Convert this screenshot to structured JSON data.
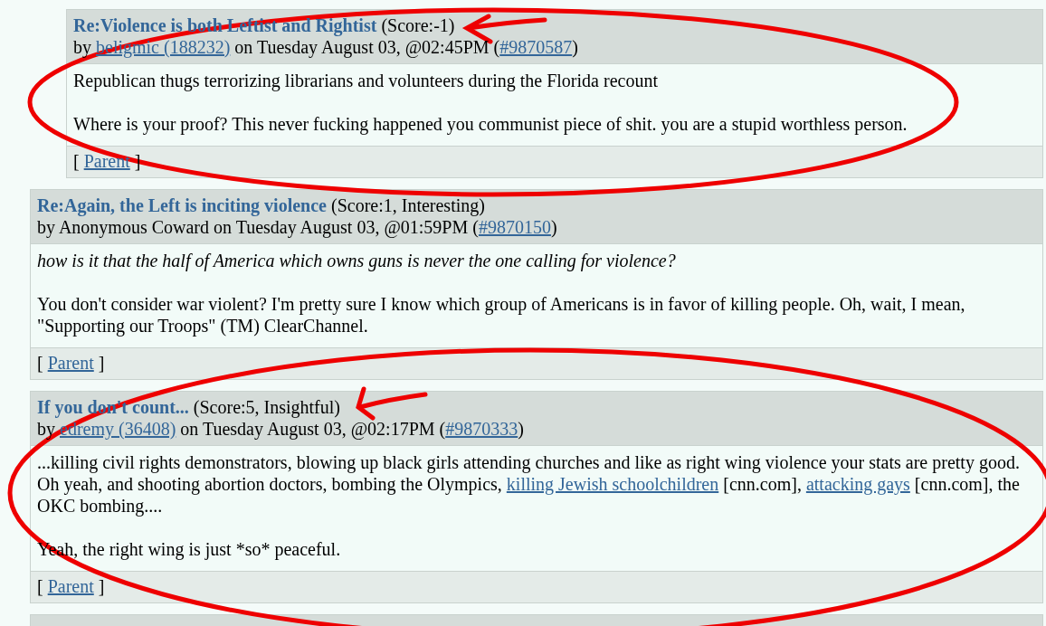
{
  "comments": [
    {
      "children": [
        {
          "title": "Re:Violence is both Leftist and Rightist",
          "score": "(Score:-1)",
          "byline": {
            "by": "by",
            "author": "beligmic (188232)",
            "author_link": true,
            "date": "on Tuesday August 03, @02:45PM (",
            "cid": "#9870587",
            "close": ")"
          },
          "paragraphs": [
            {
              "kind": "plain",
              "parts": [
                {
                  "kind": "text",
                  "text": "Republican thugs terrorizing librarians and volunteers during the Florida recount"
                }
              ]
            },
            {
              "kind": "plain",
              "parts": [
                {
                  "kind": "text",
                  "text": "Where is your proof? This never fucking happened you communist piece of shit. you are a stupid worthless person."
                }
              ]
            }
          ],
          "footer": {
            "open": "[",
            "link": "Parent",
            "close": "]"
          }
        }
      ]
    },
    {
      "title": "Re:Again, the Left is inciting violence",
      "score": "(Score:1, Interesting)",
      "byline": {
        "by": "by",
        "author": "Anonymous Coward",
        "author_link": false,
        "date": "on Tuesday August 03, @01:59PM (",
        "cid": "#9870150",
        "close": ")"
      },
      "paragraphs": [
        {
          "kind": "italic",
          "parts": [
            {
              "kind": "text",
              "text": "how is it that the half of America which owns guns is never the one calling for violence?"
            }
          ]
        },
        {
          "kind": "plain",
          "parts": [
            {
              "kind": "text",
              "text": "You don't consider war violent? I'm pretty sure I know which group of Americans is in favor of killing people. Oh, wait, I mean, \"Supporting our Troops\" (TM) ClearChannel."
            }
          ]
        }
      ],
      "footer": {
        "open": "[",
        "link": "Parent",
        "close": "]"
      }
    },
    {
      "title": "If you don't count...",
      "score": "(Score:5, Insightful)",
      "byline": {
        "by": "by",
        "author": "edremy (36408)",
        "author_link": true,
        "date": "on Tuesday August 03, @02:17PM (",
        "cid": "#9870333",
        "close": ")"
      },
      "paragraphs": [
        {
          "kind": "plain",
          "parts": [
            {
              "kind": "text",
              "text": "...killing civil rights demonstrators, blowing up black girls attending churches and like as right wing violence your stats are pretty good. Oh yeah, and shooting abortion doctors, bombing the Olympics, "
            },
            {
              "kind": "link",
              "text": "killing Jewish schoolchildren"
            },
            {
              "kind": "text",
              "text": " [cnn.com], "
            },
            {
              "kind": "link",
              "text": "attacking gays"
            },
            {
              "kind": "text",
              "text": " [cnn.com], the OKC bombing...."
            }
          ]
        },
        {
          "kind": "plain",
          "parts": [
            {
              "kind": "text",
              "text": "Yeah, the right wing is just *so* peaceful."
            }
          ]
        }
      ],
      "footer": {
        "open": "[",
        "link": "Parent",
        "close": "]"
      }
    }
  ]
}
